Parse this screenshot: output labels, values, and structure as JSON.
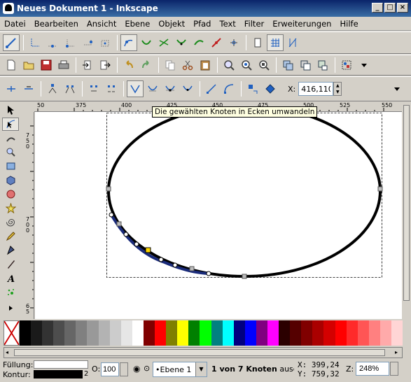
{
  "window": {
    "title": "Neues Dokument 1 - Inkscape"
  },
  "menu": [
    {
      "label": "Datei"
    },
    {
      "label": "Bearbeiten"
    },
    {
      "label": "Ansicht"
    },
    {
      "label": "Ebene"
    },
    {
      "label": "Objekt"
    },
    {
      "label": "Pfad"
    },
    {
      "label": "Text"
    },
    {
      "label": "Filter"
    },
    {
      "label": "Erweiterungen"
    },
    {
      "label": "Hilfe"
    }
  ],
  "node_toolbar": {
    "x_label": "X:",
    "x_value": "416,110"
  },
  "tooltip": "Die gewählten Knoten in Ecken umwandeln",
  "rulers": {
    "h_ticks": [
      "50",
      "375",
      "400",
      "425",
      "450",
      "475",
      "500",
      "525",
      "550"
    ],
    "v_ticks": [
      "7\n5\n0",
      "7\n0\n0",
      "6\n5"
    ]
  },
  "status": {
    "fill_label": "Füllung:",
    "stroke_label": "Kontur:",
    "stroke_width": "2",
    "opacity_label": "O:",
    "opacity_value": "100",
    "layer": "•Ebene 1",
    "message_bold": "1 von 7 Knoten",
    "message_rest": " ausge",
    "x_coord": "X:  399,24",
    "y_coord": "Y:  759,32",
    "zoom_label": "Z:",
    "zoom_value": "248%"
  },
  "palette": [
    "#000000",
    "#1a1a1a",
    "#333333",
    "#4d4d4d",
    "#666666",
    "#808080",
    "#999999",
    "#b3b3b3",
    "#cccccc",
    "#e6e6e6",
    "#ffffff",
    "#800000",
    "#ff0000",
    "#808000",
    "#ffff00",
    "#008000",
    "#00ff00",
    "#008080",
    "#00ffff",
    "#000080",
    "#0000ff",
    "#800080",
    "#ff00ff",
    "#2b0000",
    "#550000",
    "#800000",
    "#aa0000",
    "#d40000",
    "#ff0000",
    "#ff2a2a",
    "#ff5555",
    "#ff8080",
    "#ffaaaa",
    "#ffd5d5"
  ]
}
